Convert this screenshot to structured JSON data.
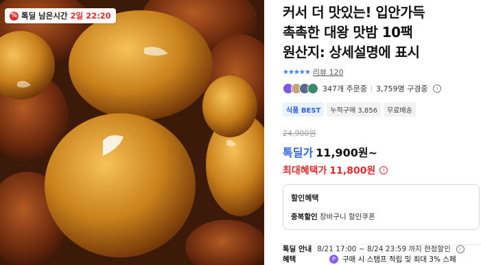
{
  "photo": {
    "timer": {
      "label": "톡딜 남은시간",
      "time": "2일 22:20",
      "badge_icon": "percent-icon"
    }
  },
  "product": {
    "title": "커서 더 맛있는! 입안가득\n촉촉한 대왕 맛밤 10팩\n원산지: 상세설명에 표시",
    "rating": {
      "stars": "★★★★★",
      "review_text": "리뷰 120"
    },
    "social": {
      "buyers": "347개 주문중",
      "watchers": "3,759명 구경중"
    },
    "tags": [
      "식품 BEST",
      "누적구매 3,856",
      "무료배송"
    ]
  },
  "price": {
    "original": "24,900원",
    "deal_label": "톡딜가",
    "deal_price": "11,900원~",
    "max_label": "최대혜택가",
    "max_price": "11,800원"
  },
  "benefits": {
    "title": "할인혜택",
    "line_key": "중복할인",
    "line_value": "장바구니 할인쿠폰"
  },
  "deal_info": {
    "label": "톡딜 안내",
    "value": "8/21 17:00 ~ 8/24 23:59 까지 한정할인"
  },
  "extra": {
    "label": "혜택",
    "value": "구매 시 스탬프 적립 및 최대 3% 스페"
  },
  "colors": {
    "accent_blue": "#2a62d8",
    "accent_red": "#e02b2b"
  }
}
